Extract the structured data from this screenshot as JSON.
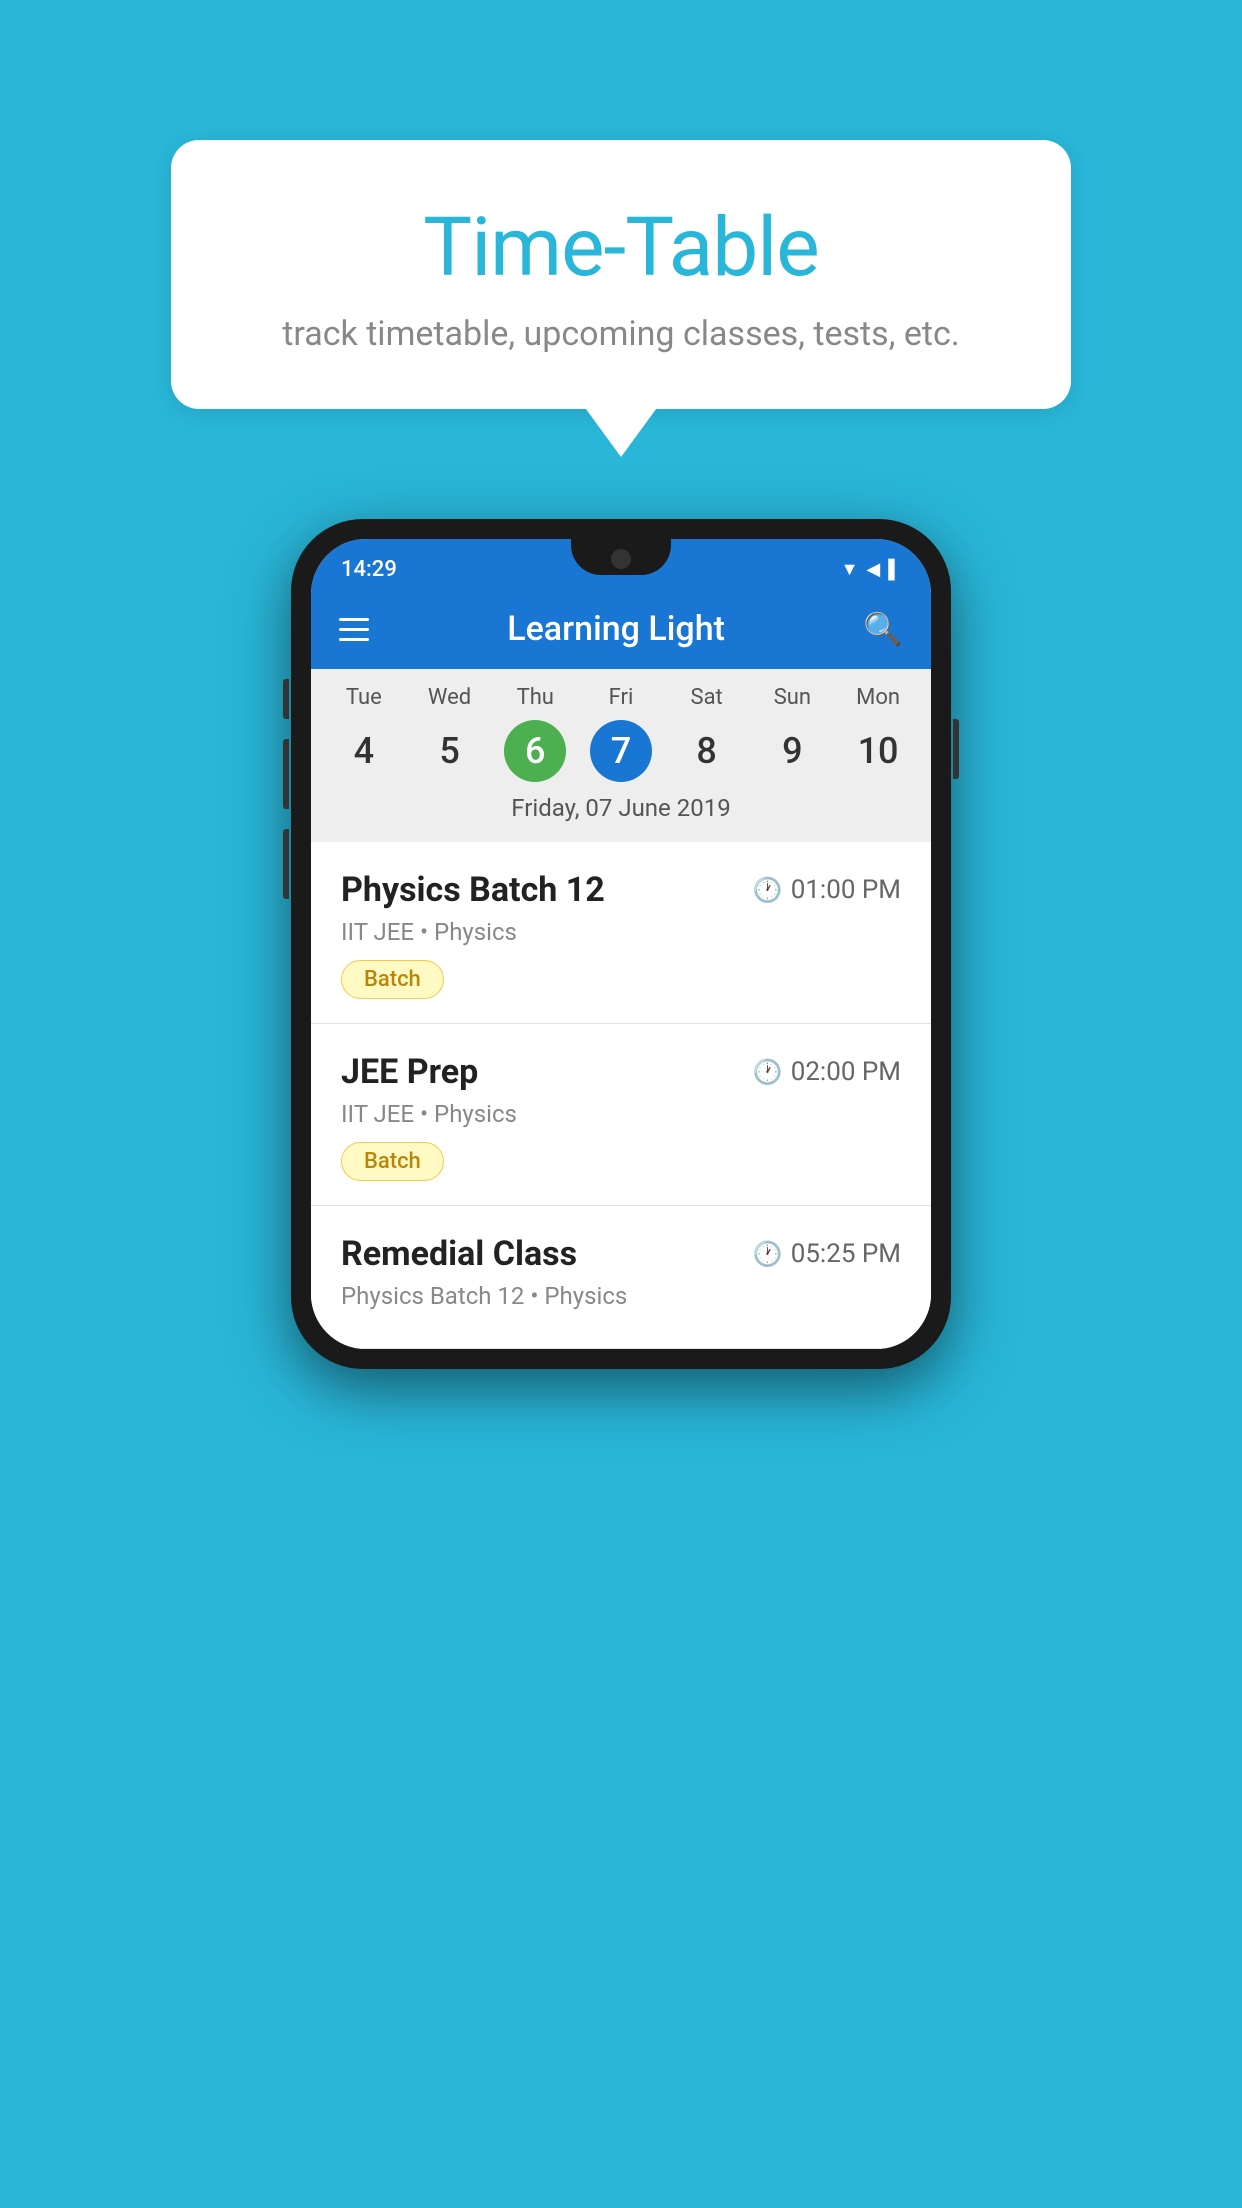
{
  "background_color": "#29B6D8",
  "bubble": {
    "title": "Time-Table",
    "subtitle": "track timetable, upcoming classes, tests, etc."
  },
  "phone": {
    "status_bar": {
      "time": "14:29",
      "icons": "▼◀▌"
    },
    "app_bar": {
      "title": "Learning Light"
    },
    "calendar": {
      "days": [
        {
          "name": "Tue",
          "num": "4",
          "state": "normal"
        },
        {
          "name": "Wed",
          "num": "5",
          "state": "normal"
        },
        {
          "name": "Thu",
          "num": "6",
          "state": "today"
        },
        {
          "name": "Fri",
          "num": "7",
          "state": "selected"
        },
        {
          "name": "Sat",
          "num": "8",
          "state": "normal"
        },
        {
          "name": "Sun",
          "num": "9",
          "state": "normal"
        },
        {
          "name": "Mon",
          "num": "10",
          "state": "normal"
        }
      ],
      "selected_date_label": "Friday, 07 June 2019"
    },
    "schedule": [
      {
        "title": "Physics Batch 12",
        "time": "01:00 PM",
        "subtitle": "IIT JEE • Physics",
        "tag": "Batch"
      },
      {
        "title": "JEE Prep",
        "time": "02:00 PM",
        "subtitle": "IIT JEE • Physics",
        "tag": "Batch"
      },
      {
        "title": "Remedial Class",
        "time": "05:25 PM",
        "subtitle": "Physics Batch 12 • Physics",
        "tag": ""
      }
    ]
  }
}
